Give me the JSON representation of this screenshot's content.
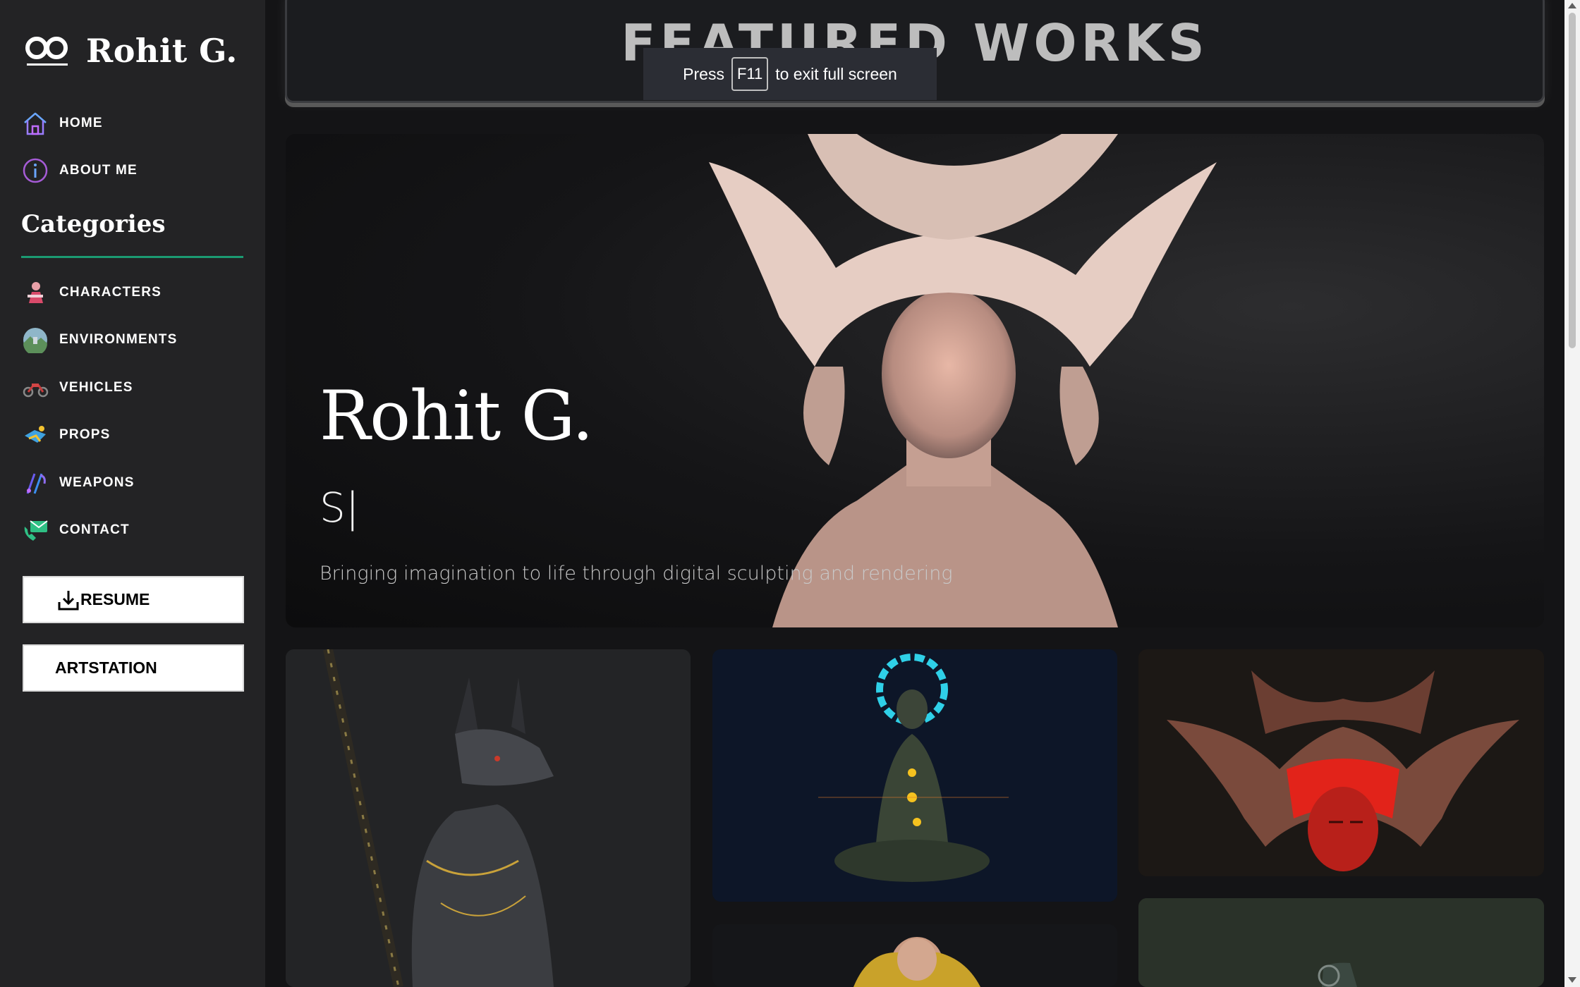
{
  "brand": {
    "title": "Rohit G."
  },
  "nav": {
    "home": "HOME",
    "about": "ABOUT ME",
    "categories_heading": "Categories",
    "categories": {
      "characters": "CHARACTERS",
      "environments": "ENVIRONMENTS",
      "vehicles": "VEHICLES",
      "props": "PROPS",
      "weapons": "WEAPONS",
      "contact": "CONTACT"
    }
  },
  "buttons": {
    "resume": "RESUME",
    "artstation": "ARTSTATION"
  },
  "featured": {
    "title": "FEATURED WORKS"
  },
  "fullscreen_toast": {
    "press": "Press",
    "key": "F11",
    "rest": "to exit full screen"
  },
  "hero": {
    "name": "Rohit G.",
    "typing": "S|",
    "tagline": "Bringing imagination to life through digital sculpting and rendering"
  },
  "colors": {
    "accent": "#1b9a72",
    "sidebar_bg": "#232325",
    "page_bg": "#141416"
  },
  "icons": {
    "brand": "infinity-logo-icon",
    "home": "home-icon",
    "about": "info-circle-icon",
    "characters": "character-thumbnail-icon",
    "environments": "globe-landscape-icon",
    "vehicles": "motorcycle-icon",
    "props": "props-icon",
    "weapons": "weapons-icon",
    "contact": "mail-phone-icon",
    "resume": "download-icon"
  }
}
